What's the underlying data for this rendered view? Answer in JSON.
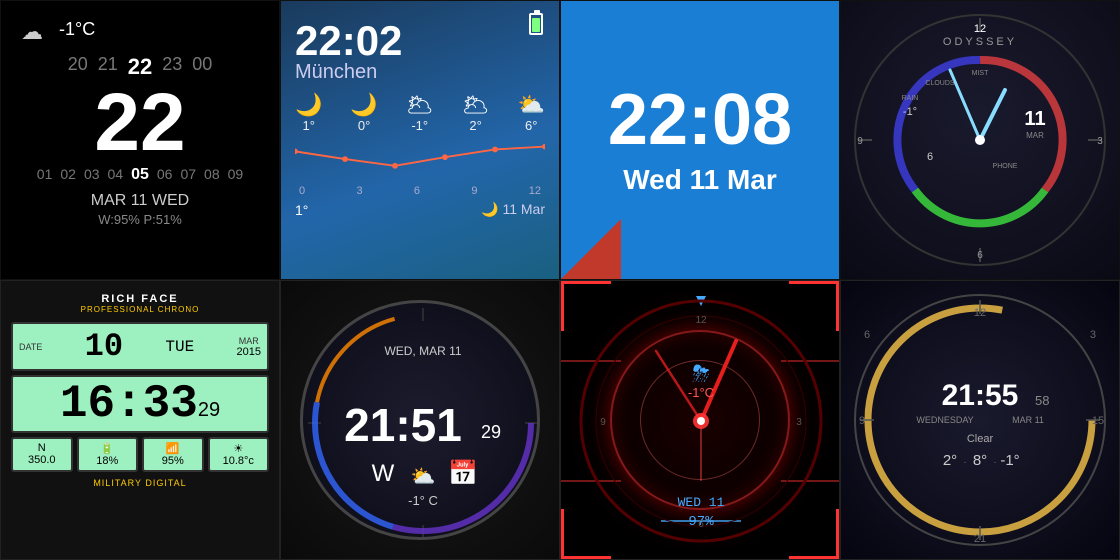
{
  "cells": {
    "cell1": {
      "weather_icon": "☁",
      "temp": "-1°C",
      "numbers_top": [
        "20",
        "21",
        "22",
        "23",
        "00"
      ],
      "hour": "22",
      "numbers_bottom": [
        "01",
        "02",
        "03",
        "04",
        "05",
        "06",
        "07",
        "08",
        "09"
      ],
      "minute": "05",
      "date": "MAR 11 WED",
      "stats": "W:95% P:51%"
    },
    "cell2": {
      "time": "22:02",
      "city": "München",
      "forecast": [
        {
          "icon": "🌙",
          "temp": "1°"
        },
        {
          "icon": "🌙",
          "temp": "0°"
        },
        {
          "icon": "🌥",
          "temp": "-1°"
        },
        {
          "icon": "🌥",
          "temp": "2°"
        },
        {
          "icon": "⛅",
          "temp": "6°"
        }
      ],
      "time_labels": [
        "0",
        "3",
        "6",
        "9",
        "12"
      ],
      "bottom_temp": "1°",
      "bottom_date": "🌙 11 Mar"
    },
    "cell3": {
      "time": "22:08",
      "date": "Wed 11 Mar"
    },
    "cell4": {
      "label": "ODYSSEY",
      "numbers": [
        "12",
        "3",
        "6",
        "9"
      ],
      "labels": [
        "RAIN",
        "CLOUDS",
        "MIST"
      ],
      "mar_label": "MAR",
      "temp": "-1°",
      "val_6": "6",
      "val_11": "11"
    },
    "cell5": {
      "brand": "RICH FACE",
      "brand_sub": "PROFESSIONAL CHRONO",
      "date_label": "DATE",
      "date_val": "10",
      "day_val": "TUE",
      "year_val": "2015",
      "month_val": "MAR",
      "time": "16:33",
      "sec": "29",
      "stats": [
        "N 350.0",
        "18%",
        "95%",
        "☀ 10.8°c"
      ],
      "military": "MILITARY DIGITAL"
    },
    "cell6": {
      "date": "WED, MAR 11",
      "hour": "21",
      "min": "51",
      "sec": "29",
      "weather_icon": "⛅",
      "temp_label": "-1° C",
      "calendar_icon": "📅"
    },
    "cell7": {
      "weather_icon": "⛈",
      "temp": "-1°C",
      "time": "WED 11",
      "battery": "97%"
    },
    "cell8": {
      "time": "21:55",
      "sec": "58",
      "day": "WEDNESDAY",
      "date": "MAR 11",
      "weather": "Clear",
      "temp1": "2°",
      "temp2": "8°",
      "temp3": "-1°",
      "tick_nums": [
        "12",
        "15",
        "3",
        "6",
        "21",
        "9"
      ]
    }
  }
}
